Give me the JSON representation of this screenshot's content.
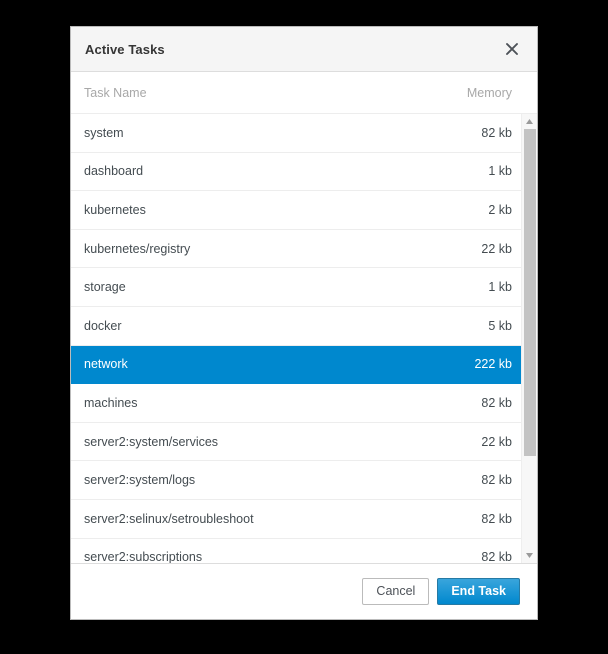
{
  "dialog": {
    "title": "Active Tasks",
    "close_icon": "close-icon"
  },
  "table": {
    "columns": {
      "name": "Task Name",
      "memory": "Memory"
    },
    "rows": [
      {
        "name": "system",
        "memory": "82 kb",
        "selected": false
      },
      {
        "name": "dashboard",
        "memory": "1 kb",
        "selected": false
      },
      {
        "name": "kubernetes",
        "memory": "2 kb",
        "selected": false
      },
      {
        "name": "kubernetes/registry",
        "memory": "22 kb",
        "selected": false
      },
      {
        "name": "storage",
        "memory": "1 kb",
        "selected": false
      },
      {
        "name": "docker",
        "memory": "5 kb",
        "selected": false
      },
      {
        "name": "network",
        "memory": "222 kb",
        "selected": true
      },
      {
        "name": "machines",
        "memory": "82 kb",
        "selected": false
      },
      {
        "name": "server2:system/services",
        "memory": "22 kb",
        "selected": false
      },
      {
        "name": "server2:system/logs",
        "memory": "82 kb",
        "selected": false
      },
      {
        "name": "server2:selinux/setroubleshoot",
        "memory": "82 kb",
        "selected": false
      },
      {
        "name": "server2:subscriptions",
        "memory": "82 kb",
        "selected": false
      }
    ]
  },
  "scrollbar": {
    "up_icon": "triangle-up-icon",
    "down_icon": "triangle-down-icon",
    "thumb_percent": 78
  },
  "footer": {
    "cancel_label": "Cancel",
    "end_task_label": "End Task"
  },
  "colors": {
    "selection_blue": "#0088ce",
    "primary_button": "#0088ce",
    "header_bg": "#f5f5f5",
    "backdrop": "#000000"
  }
}
